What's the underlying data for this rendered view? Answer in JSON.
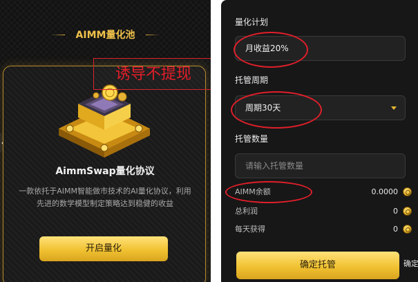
{
  "left_panel": {
    "pool_title": "AIMM量化池",
    "nav_arrow": "‹",
    "protocol_name": "AimmSwap量化协议",
    "protocol_description": "一款依托于AIMM智能做市技术的AI量化协议，利用先进的数学模型制定策略达到稳健的收益",
    "start_button_label": "开启量化",
    "warning_text": "诱导不提现"
  },
  "right_panel": {
    "plan_label": "量化计划",
    "plan_value": "月收益20%",
    "period_label": "托管周期",
    "period_value": "周期30天",
    "amount_label": "托管数量",
    "amount_placeholder": "请输入托管数量",
    "stats": [
      {
        "label": "AIMM余额",
        "value": "0.0000"
      },
      {
        "label": "总利润",
        "value": "0"
      },
      {
        "label": "每天获得",
        "value": "0"
      }
    ],
    "confirm_button_label": "确定托管",
    "confirm_fragment": "确定"
  },
  "colors": {
    "accent_gold": "#f1c232",
    "annotation_red": "#e01f2a",
    "panel_background": "#171717"
  },
  "icons": [
    "left-arrow-icon",
    "coin-icon",
    "dropdown-caret-icon",
    "quant-machine-illustration"
  ]
}
